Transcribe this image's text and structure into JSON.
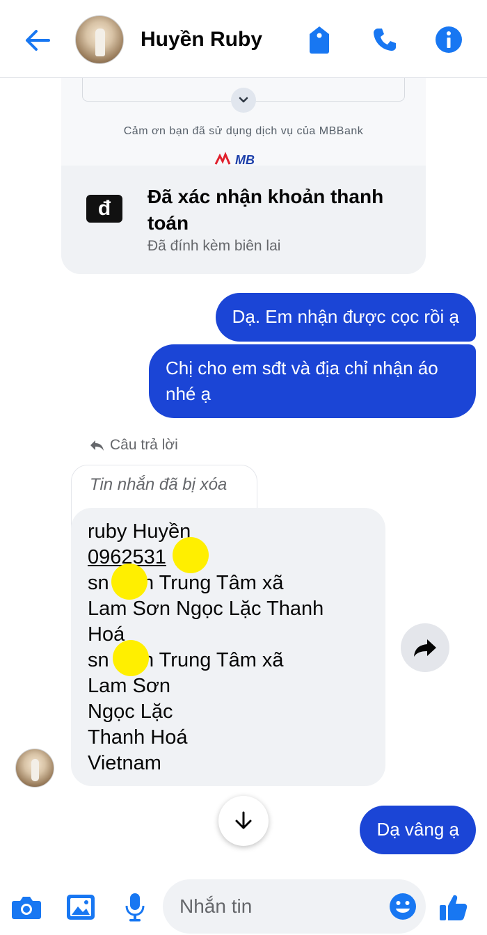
{
  "header": {
    "contact_name": "Huyền Ruby"
  },
  "receipt": {
    "thanks_text": "Cảm ơn bạn đã sử dụng dịch vụ của MBBank",
    "bank_logo_text": "MB",
    "currency_symbol": "đ",
    "title": "Đã xác nhận khoản thanh toán",
    "subtitle": "Đã đính kèm biên lai"
  },
  "messages": {
    "out1": "Dạ. Em nhận được cọc rồi ạ",
    "out2": "Chị cho em sđt và địa chỉ nhận áo nhé ạ",
    "reply_label": "Câu trả lời",
    "deleted_text": "Tin nhắn đã bị xóa",
    "incoming_lines": [
      "ruby Huyền",
      "0962531",
      "sn thôn Trung Tâm xã",
      "Lam Sơn Ngọc Lặc Thanh",
      "Hoá",
      "sn thôn Trung Tâm xã",
      "Lam Sơn",
      "Ngọc Lặc",
      "Thanh Hoá",
      "Vietnam"
    ],
    "out3": "Dạ vâng ạ"
  },
  "composer": {
    "placeholder": "Nhắn tin"
  },
  "colors": {
    "accent": "#1b45d6",
    "icon_blue": "#1877f2",
    "redaction": "#ffef00"
  },
  "icons": [
    "back-arrow-icon",
    "tag-icon",
    "phone-icon",
    "info-icon",
    "chevron-down-icon",
    "reply-icon",
    "forward-icon",
    "arrow-down-icon",
    "camera-icon",
    "image-icon",
    "mic-icon",
    "emoji-icon",
    "thumbs-up-icon"
  ]
}
